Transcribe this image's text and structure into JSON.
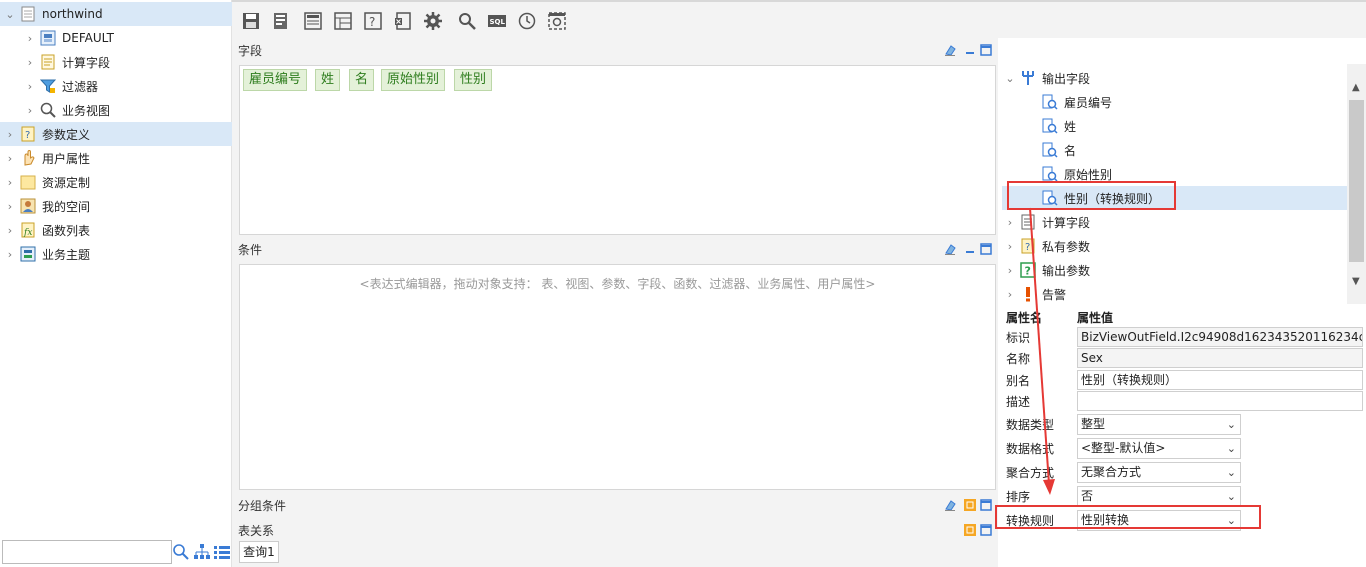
{
  "left_tree": {
    "items": [
      {
        "label": "northwind",
        "icon": "database-icon"
      },
      {
        "label": "DEFAULT",
        "icon": "schema-icon"
      },
      {
        "label": "计算字段",
        "icon": "calc-field-icon"
      },
      {
        "label": "过滤器",
        "icon": "filter-icon"
      },
      {
        "label": "业务视图",
        "icon": "search-icon"
      },
      {
        "label": "参数定义",
        "icon": "param-icon"
      },
      {
        "label": "用户属性",
        "icon": "hand-icon"
      },
      {
        "label": "资源定制",
        "icon": "folder-icon"
      },
      {
        "label": "我的空间",
        "icon": "user-icon"
      },
      {
        "label": "函数列表",
        "icon": "function-icon"
      },
      {
        "label": "业务主题",
        "icon": "topic-icon"
      }
    ],
    "search_placeholder": ""
  },
  "panels": {
    "fields": {
      "title": "字段",
      "chips": [
        "雇员编号",
        "姓",
        "名",
        "原始性别",
        "性别"
      ]
    },
    "conditions": {
      "title": "条件",
      "hint": "<表达式编辑器，拖动对象支持： 表、视图、参数、字段、函数、过滤器、业务属性、用户属性>"
    },
    "group": {
      "title": "分组条件"
    },
    "relations": {
      "title": "表关系",
      "tab": "查询1"
    }
  },
  "right_tree": {
    "output_fields_label": "输出字段",
    "output_fields": [
      "雇员编号",
      "姓",
      "名",
      "原始性别",
      "性别（转换规则）"
    ],
    "others": [
      "计算字段",
      "私有参数",
      "输出参数",
      "告警"
    ]
  },
  "properties": {
    "header_name": "属性名",
    "header_value": "属性值",
    "rows": [
      {
        "label": "标识",
        "value": "BizViewOutField.I2c94908d162343520116234c"
      },
      {
        "label": "名称",
        "value": "Sex"
      },
      {
        "label": "别名",
        "value": "性别（转换规则）"
      },
      {
        "label": "描述",
        "value": ""
      },
      {
        "label": "数据类型",
        "value": "整型"
      },
      {
        "label": "数据格式",
        "value": "<整型-默认值>"
      },
      {
        "label": "聚合方式",
        "value": "无聚合方式"
      },
      {
        "label": "排序",
        "value": "否"
      },
      {
        "label": "转换规则",
        "value": "性别转换"
      }
    ]
  },
  "colors": {
    "highlight": "#e53935",
    "selection": "#d9e8f7",
    "chip_bg": "#e4f1d9"
  }
}
